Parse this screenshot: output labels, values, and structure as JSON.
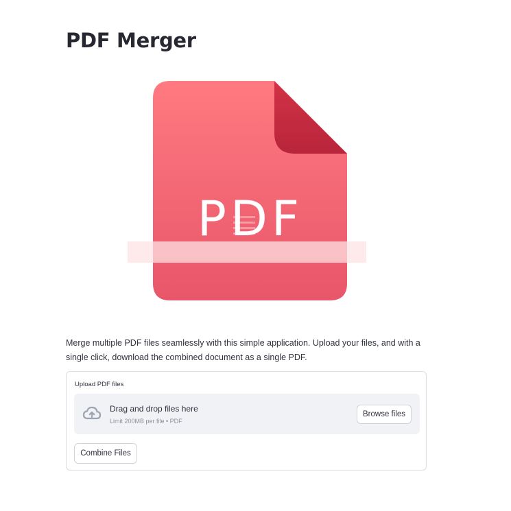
{
  "page": {
    "title": "PDF Merger",
    "description": "Merge multiple PDF files seamlessly with this simple application. Upload your files, and with a single click, download the combined document as a single PDF."
  },
  "hero": {
    "icon": "pdf-file-icon",
    "label": "PDF",
    "colors": {
      "body_top": "#ff7a80",
      "body_bottom": "#e9576a",
      "fold": "#c42c42",
      "band": "#fbd3d6"
    }
  },
  "uploader": {
    "label": "Upload PDF files",
    "drop_text": "Drag and drop files here",
    "limit_text": "Limit 200MB per file • PDF",
    "browse_label": "Browse files",
    "icon": "cloud-upload-icon"
  },
  "actions": {
    "combine_label": "Combine Files"
  }
}
